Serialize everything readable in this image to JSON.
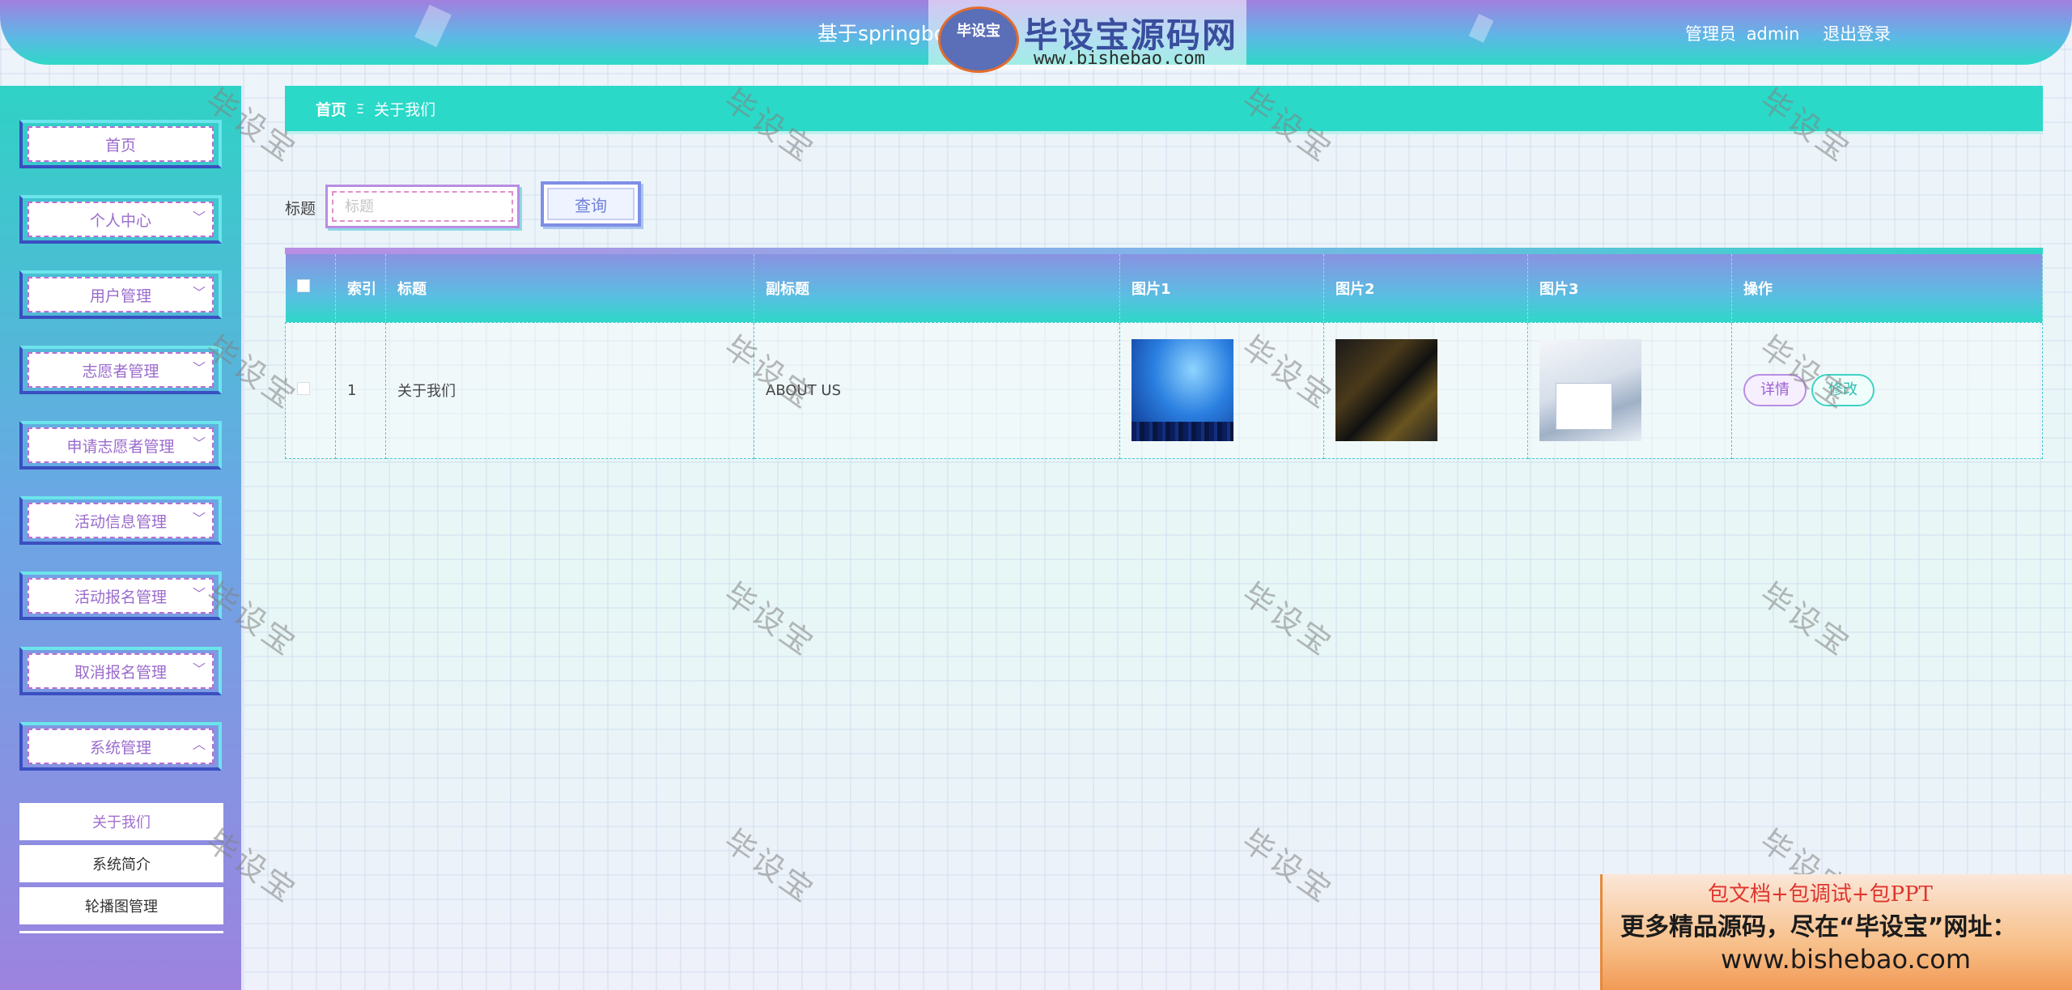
{
  "header": {
    "system_title": "基于springboot",
    "role": "管理员",
    "username": "admin",
    "logout_label": "退出登录"
  },
  "logo": {
    "badge": "毕设宝",
    "name": "毕设宝源码网",
    "url": "www.bishebao.com"
  },
  "sidebar": {
    "items": [
      {
        "label": "首页"
      },
      {
        "label": "个人中心"
      },
      {
        "label": "用户管理"
      },
      {
        "label": "志愿者管理"
      },
      {
        "label": "申请志愿者管理"
      },
      {
        "label": "活动信息管理"
      },
      {
        "label": "活动报名管理"
      },
      {
        "label": "取消报名管理"
      },
      {
        "label": "系统管理"
      }
    ],
    "submenu": [
      {
        "label": "关于我们"
      },
      {
        "label": "系统简介"
      },
      {
        "label": "轮播图管理"
      }
    ]
  },
  "breadcrumb": {
    "home": "首页",
    "separator": "Ξ",
    "current": "关于我们"
  },
  "search": {
    "label": "标题",
    "placeholder": "标题",
    "button_label": "查询"
  },
  "table": {
    "columns": [
      "索引",
      "标题",
      "副标题",
      "图片1",
      "图片2",
      "图片3",
      "操作"
    ],
    "rows": [
      {
        "index": "1",
        "title": "关于我们",
        "subtitle": "ABOUT US",
        "detail_label": "详情",
        "edit_label": "修改"
      }
    ]
  },
  "watermark": "毕设宝",
  "ad": {
    "line1": "包文档+包调试+包PPT",
    "line2": "更多精品源码，尽在“毕设宝”网址：",
    "line3": "www.bishebao.com"
  }
}
